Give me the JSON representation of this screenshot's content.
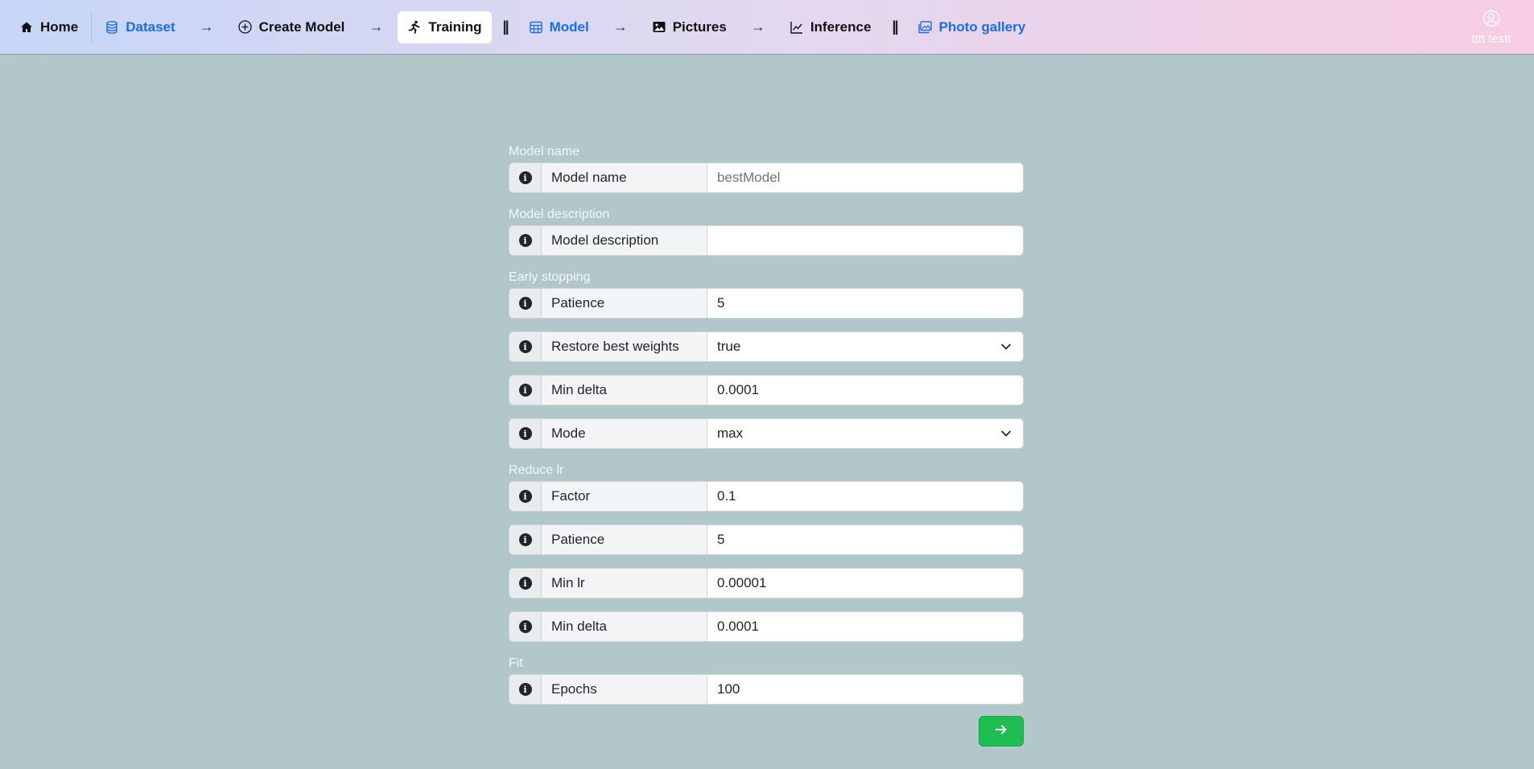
{
  "nav": {
    "home": "Home",
    "dataset": "Dataset",
    "create_model": "Create Model",
    "training": "Training",
    "model": "Model",
    "pictures": "Pictures",
    "inference": "Inference",
    "photo_gallery": "Photo gallery",
    "arrow": "→",
    "pause": "||"
  },
  "user": {
    "name": "tttt testt",
    "icon": "user-circle-icon"
  },
  "form": {
    "model_name": {
      "section": "Model name",
      "label": "Model name",
      "placeholder": "bestModel",
      "value": ""
    },
    "model_description": {
      "section": "Model description",
      "label": "Model description",
      "value": ""
    },
    "early_stopping": {
      "section": "Early stopping",
      "patience": {
        "label": "Patience",
        "value": "5"
      },
      "restore_best_weights": {
        "label": "Restore best weights",
        "value": "true"
      },
      "min_delta": {
        "label": "Min delta",
        "value": "0.0001"
      },
      "mode": {
        "label": "Mode",
        "value": "max"
      }
    },
    "reduce_lr": {
      "section": "Reduce lr",
      "factor": {
        "label": "Factor",
        "value": "0.1"
      },
      "patience": {
        "label": "Patience",
        "value": "5"
      },
      "min_lr": {
        "label": "Min lr",
        "value": "0.00001"
      },
      "min_delta": {
        "label": "Min delta",
        "value": "0.0001"
      }
    },
    "fit": {
      "section": "Fit",
      "epochs": {
        "label": "Epochs",
        "value": "100"
      }
    },
    "info_glyph": "i"
  },
  "colors": {
    "background": "#b2c7c9",
    "accent_blue": "#1a6fe0",
    "submit_green": "#1fbd52"
  }
}
